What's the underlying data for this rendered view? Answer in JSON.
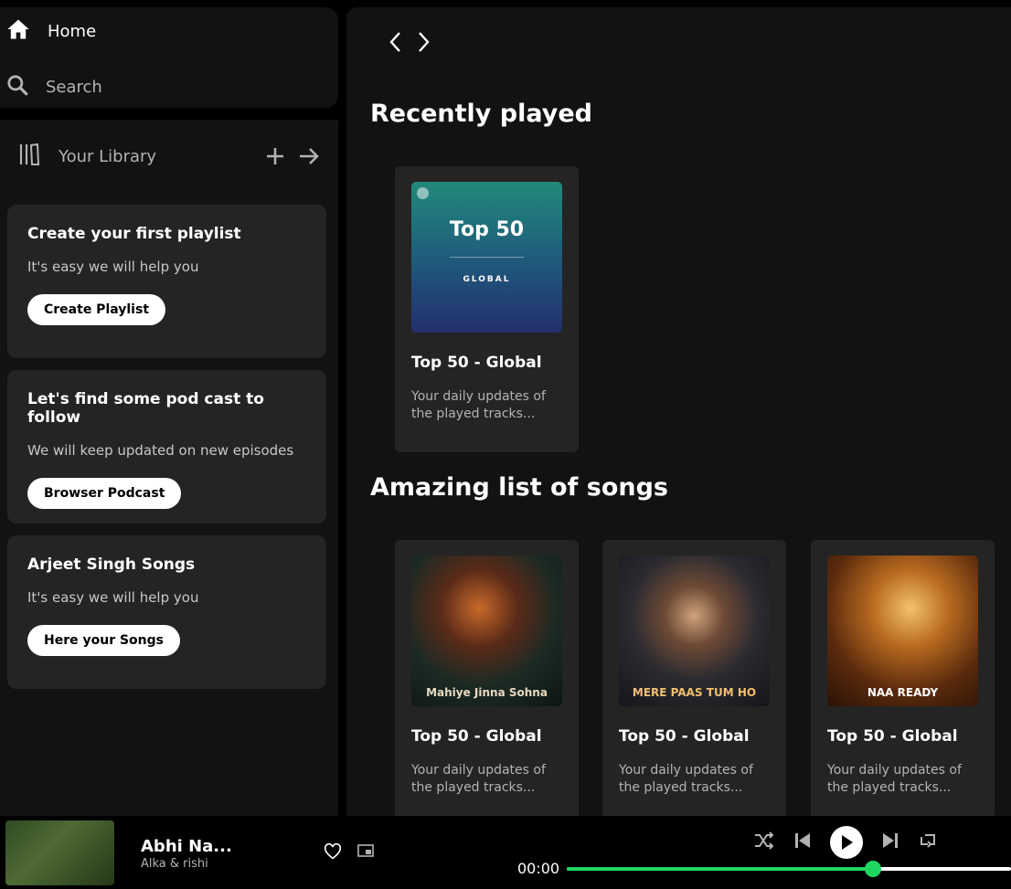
{
  "nav": {
    "home_label": "Home",
    "search_label": "Search"
  },
  "library": {
    "label": "Your Library",
    "cards": [
      {
        "title": "Create your first playlist",
        "subtitle": "It's easy we will help you",
        "button": "Create Playlist"
      },
      {
        "title": "Let's find some pod cast to follow",
        "subtitle": "We will keep updated on new episodes",
        "button": "Browser Podcast"
      },
      {
        "title": "Arjeet Singh Songs",
        "subtitle": "It's easy we will help you",
        "button": "Here your Songs"
      }
    ]
  },
  "main": {
    "recent_title": "Recently played",
    "recent": [
      {
        "title": "Top 50 - Global",
        "desc": "Your daily updates of the played tracks...",
        "art_text": "Top 50",
        "art_sub": "GLOBAL"
      }
    ],
    "amazing_title": "Amazing list of songs",
    "amazing": [
      {
        "title": "Top 50 - Global",
        "desc": "Your daily updates of the played tracks...",
        "art_caption": "Mahiye Jinna Sohna"
      },
      {
        "title": "Top 50 - Global",
        "desc": "Your daily updates of the played tracks...",
        "art_caption": "MERE PAAS TUM HO"
      },
      {
        "title": "Top 50 - Global",
        "desc": "Your daily updates of the played tracks...",
        "art_caption": "NAA READY"
      }
    ]
  },
  "player": {
    "song": "Abhi Na...",
    "artist": "Alka & rishi",
    "time": "00:00",
    "progress": 0.69
  },
  "colors": {
    "accent": "#1ed760",
    "panel": "#121212",
    "card": "#242424"
  }
}
